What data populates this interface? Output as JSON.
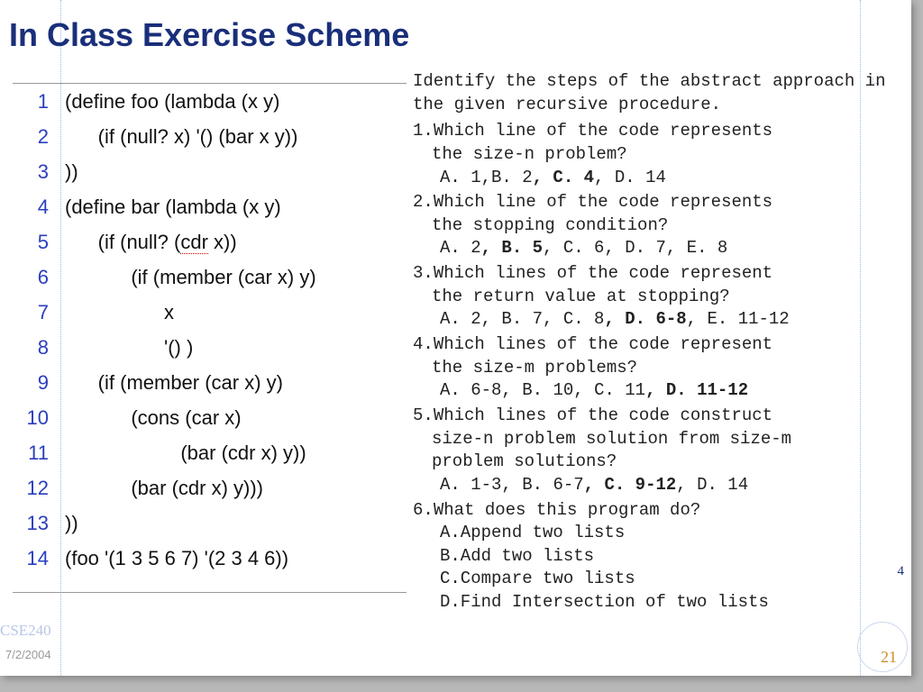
{
  "title": "In Class Exercise Scheme",
  "code": {
    "lines": [
      {
        "n": "1",
        "t": "(define foo (lambda (x y)"
      },
      {
        "n": "2",
        "t": "      (if (null? x) '() (bar x y))"
      },
      {
        "n": "3",
        "t": "))"
      },
      {
        "n": "4",
        "t": "(define bar (lambda (x y)"
      },
      {
        "n": "5",
        "t": "      (if (null? (",
        "spell": "cdr",
        "after": " x))"
      },
      {
        "n": "6",
        "t": "            (if (member (car x) y)"
      },
      {
        "n": "7",
        "t": "                  x"
      },
      {
        "n": "8",
        "t": "                  '() )"
      },
      {
        "n": "9",
        "t": "      (if (member (car x) y)"
      },
      {
        "n": "10",
        "t": "            (cons (car x)"
      },
      {
        "n": "11",
        "t": "                     (bar (cdr x) y))"
      },
      {
        "n": "12",
        "t": "            (bar (cdr x) y)))"
      },
      {
        "n": "13",
        "t": "))"
      },
      {
        "n": "14",
        "t": "(foo '(1 3 5 6 7) '(2 3 4 6))"
      }
    ]
  },
  "questions": {
    "intro": "Identify the steps of the abstract approach in the given recursive procedure.",
    "items": [
      {
        "num": "1.",
        "q1": "Which line of the code represents",
        "q2": "the size-n problem?",
        "opts": [
          {
            "t": "A. 1",
            "b": false
          },
          {
            "t": ",",
            "b": false
          },
          {
            "t": "B. 2",
            "b": false
          },
          {
            "t": ", C. 4",
            "b": true
          },
          {
            "t": ", ",
            "b": false
          },
          {
            "t": "D. 14",
            "b": false
          }
        ]
      },
      {
        "num": "2.",
        "q1": "Which line of the code represents",
        "q2": "the stopping condition?",
        "opts": [
          {
            "t": "A. 2",
            "b": false
          },
          {
            "t": ", B. 5",
            "b": true
          },
          {
            "t": ", ",
            "b": false
          },
          {
            "t": "C. 6",
            "b": false
          },
          {
            "t": ", ",
            "b": false
          },
          {
            "t": "D. 7",
            "b": false
          },
          {
            "t": ", ",
            "b": false
          },
          {
            "t": "E. 8",
            "b": false
          }
        ]
      },
      {
        "num": "3.",
        "q1": "Which lines of the code represent",
        "q2": "the return value at stopping?",
        "opts": [
          {
            "t": "A. 2",
            "b": false
          },
          {
            "t": ", ",
            "b": false
          },
          {
            "t": "B. 7",
            "b": false
          },
          {
            "t": ", ",
            "b": false
          },
          {
            "t": "C. 8",
            "b": false
          },
          {
            "t": ", D. 6-8",
            "b": true
          },
          {
            "t": ", ",
            "b": false
          },
          {
            "t": "E. 11-12",
            "b": false
          }
        ]
      },
      {
        "num": "4.",
        "q1": "Which lines of the code represent",
        "q2": "the size-m problems?",
        "opts": [
          {
            "t": "A. 6-8",
            "b": false
          },
          {
            "t": ", ",
            "b": false
          },
          {
            "t": "B. 10",
            "b": false
          },
          {
            "t": ", ",
            "b": false
          },
          {
            "t": "C. 11",
            "b": false
          },
          {
            "t": ", D. 11-12",
            "b": true
          }
        ]
      },
      {
        "num": "5.",
        "q1": "Which lines of the code construct",
        "q2": "size-n problem solution from size-m",
        "q3": "problem solutions?",
        "opts": [
          {
            "t": "A. 1-3",
            "b": false
          },
          {
            "t": ", ",
            "b": false
          },
          {
            "t": "B. 6-7",
            "b": false
          },
          {
            "t": ", C. 9-12",
            "b": true
          },
          {
            "t": ", ",
            "b": false
          },
          {
            "t": "D. 14",
            "b": false
          }
        ]
      },
      {
        "num": "6.",
        "q1": "What does this program do?",
        "letter_opts": [
          "A.Append two lists",
          "B.Add two lists",
          "C.Compare two lists",
          "D.Find Intersection of two lists"
        ]
      }
    ]
  },
  "footer": {
    "course": "CSE240",
    "date": "7/2/2004",
    "slide_num": "21",
    "corner": "4"
  }
}
